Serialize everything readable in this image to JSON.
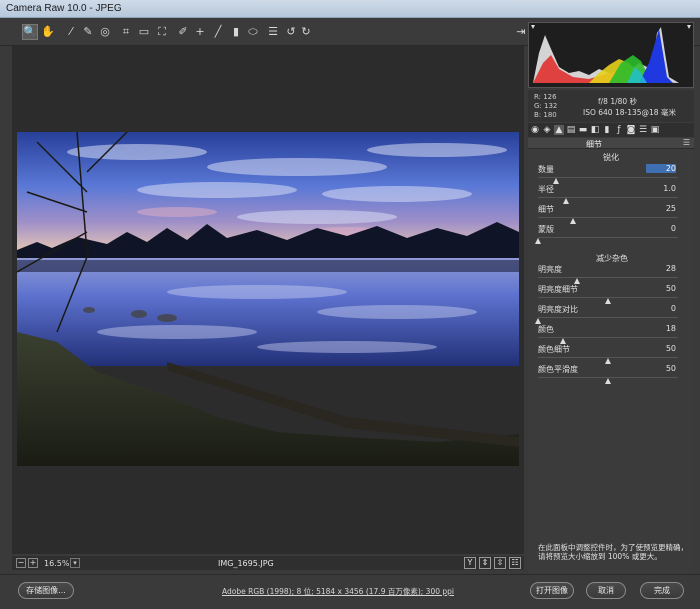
{
  "window": {
    "title": "Camera Raw 10.0 -  JPEG"
  },
  "toolbar": {
    "tools": [
      {
        "name": "zoom-tool-icon",
        "glyph": "🔍"
      },
      {
        "name": "hand-tool-icon",
        "glyph": "✋"
      },
      {
        "name": "white-balance-tool-icon",
        "glyph": "⁄"
      },
      {
        "name": "color-sampler-tool-icon",
        "glyph": "✎"
      },
      {
        "name": "targeted-adjustment-tool-icon",
        "glyph": "◎"
      },
      {
        "name": "crop-tool-icon",
        "glyph": "⌗"
      },
      {
        "name": "straighten-tool-icon",
        "glyph": "▭"
      },
      {
        "name": "transform-tool-icon",
        "glyph": "⛶"
      },
      {
        "name": "spot-removal-tool-icon",
        "glyph": "✐"
      },
      {
        "name": "red-eye-tool-icon",
        "glyph": "+"
      },
      {
        "name": "adjustment-brush-icon",
        "glyph": "╱"
      },
      {
        "name": "graduated-filter-icon",
        "glyph": "▮"
      },
      {
        "name": "radial-filter-icon",
        "glyph": "⬭"
      },
      {
        "name": "preferences-icon",
        "glyph": "☰"
      },
      {
        "name": "rotate-left-icon",
        "glyph": "↺"
      },
      {
        "name": "rotate-right-icon",
        "glyph": "↻"
      }
    ],
    "fullscreen_glyph": "⇥"
  },
  "canvas": {
    "zoom": "16.5%",
    "zoom_out_glyph": "−",
    "zoom_in_glyph": "+",
    "zoom_dropdown_glyph": "▾",
    "filename": "IMG_1695.JPG",
    "view_buttons": [
      "Y",
      "⇕",
      "⇳",
      "☷"
    ]
  },
  "info": {
    "r": "R:  126",
    "g": "G:  132",
    "b": "B:  180",
    "exposure": "f/8  1/80 秒",
    "iso_lens": "ISO 640  18-135@18 毫米"
  },
  "panel": {
    "section_title": "细节",
    "sharpen_title": "锐化",
    "sharpen": [
      {
        "label": "数量",
        "value": "20",
        "pos": 0.13
      },
      {
        "label": "半径",
        "value": "1.0",
        "pos": 0.2
      },
      {
        "label": "细节",
        "value": "25",
        "pos": 0.25
      },
      {
        "label": "蒙版",
        "value": "0",
        "pos": 0.0
      }
    ],
    "noise_title": "减少杂色",
    "noise": [
      {
        "label": "明亮度",
        "value": "28",
        "pos": 0.28
      },
      {
        "label": "明亮度细节",
        "value": "50",
        "pos": 0.5
      },
      {
        "label": "明亮度对比",
        "value": "0",
        "pos": 0.0
      },
      {
        "label": "颜色",
        "value": "18",
        "pos": 0.18
      },
      {
        "label": "颜色细节",
        "value": "50",
        "pos": 0.5
      },
      {
        "label": "颜色平滑度",
        "value": "50",
        "pos": 0.5
      }
    ],
    "hint_line1": "在此面板中调整控件时，为了使预览更精确，",
    "hint_line2": "请将预览大小缩放到 100% 或更大。"
  },
  "bottom": {
    "save_label": "存储图像...",
    "workflow": "Adobe RGB (1998); 8 位; 5184 x 3456 (17.9 百万像素); 300 ppi",
    "open_label": "打开图像",
    "cancel_label": "取消",
    "done_label": "完成"
  },
  "colors": {
    "accent": "#3f6fb0",
    "panel_bg": "#3b3b3b"
  }
}
